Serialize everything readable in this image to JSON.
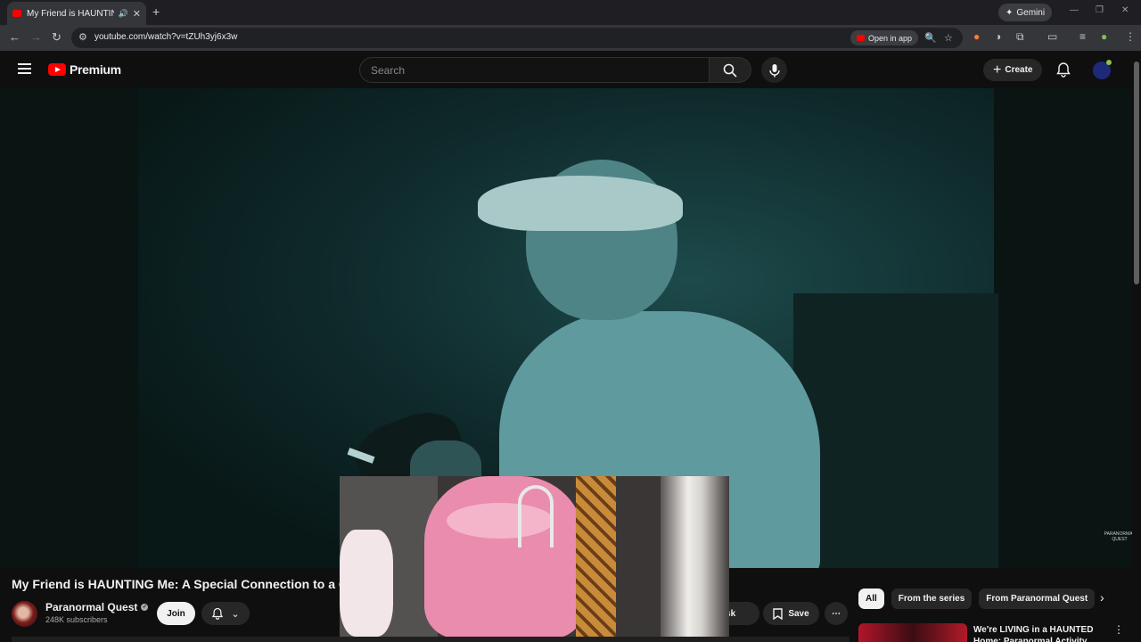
{
  "browser": {
    "tab_title": "My Friend is HAUNTING Me: A Special Connection to a Ghost",
    "new_tab": "+",
    "gemini_label": "Gemini",
    "url": "youtube.com/watch?v=tZUh3yj6x3w",
    "open_in_app": "Open in app"
  },
  "masthead": {
    "logo_text": "Premium",
    "search_placeholder": "Search",
    "create_label": "Create"
  },
  "video": {
    "title": "My Friend is HAUNTING Me: A Special Connection to a G",
    "watermark": "PARANORMAL QUEST"
  },
  "channel": {
    "name": "Paranormal Quest",
    "subscribers": "248K subscribers",
    "join_label": "Join"
  },
  "actions": {
    "ask_label": "Ask",
    "save_label": "Save"
  },
  "chips": [
    "All",
    "From the series",
    "From Paranormal Quest"
  ],
  "recommendation": {
    "title": "We're LIVING in a HAUNTED Home: Paranormal Activity"
  }
}
